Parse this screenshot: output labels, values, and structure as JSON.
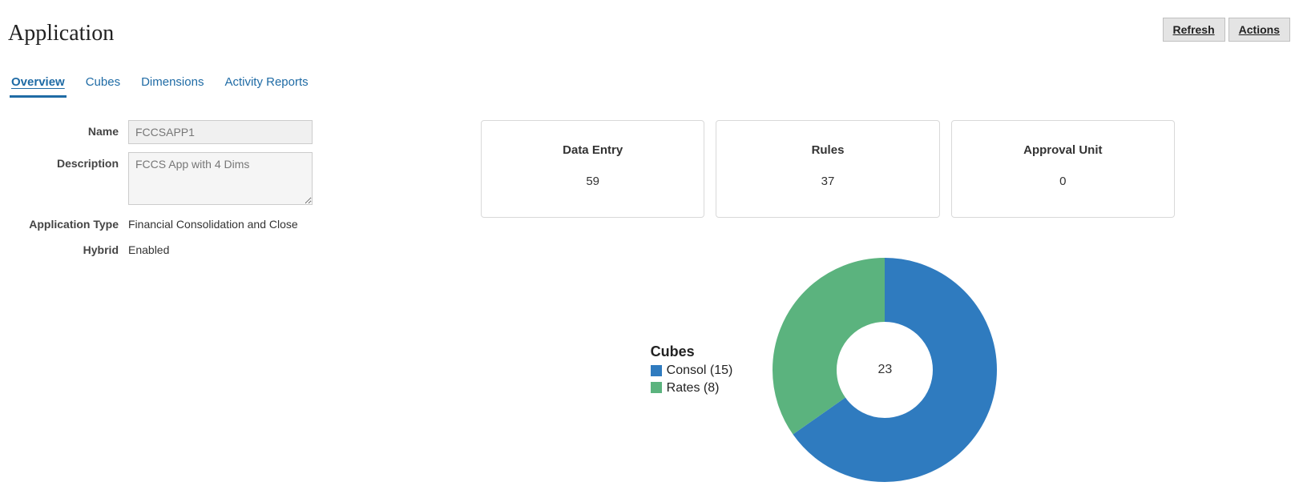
{
  "header": {
    "title": "Application",
    "refresh_label": "Refresh",
    "actions_label": "Actions"
  },
  "tabs": {
    "overview": "Overview",
    "cubes": "Cubes",
    "dimensions": "Dimensions",
    "activity": "Activity Reports"
  },
  "form": {
    "name_label": "Name",
    "name_value": "FCCSAPP1",
    "desc_label": "Description",
    "desc_value": "FCCS App with 4 Dims",
    "apptype_label": "Application Type",
    "apptype_value": "Financial Consolidation and Close",
    "hybrid_label": "Hybrid",
    "hybrid_value": "Enabled"
  },
  "stats": {
    "data_entry": {
      "label": "Data Entry",
      "value": "59"
    },
    "rules": {
      "label": "Rules",
      "value": "37"
    },
    "approval": {
      "label": "Approval Unit",
      "value": "0"
    }
  },
  "chart_data": {
    "type": "pie",
    "title": "Cubes",
    "center_total": "23",
    "series": [
      {
        "name": "Consol",
        "value": 15,
        "color": "#2f7bbf",
        "legend": "Consol (15)"
      },
      {
        "name": "Rates",
        "value": 8,
        "color": "#5bb37e",
        "legend": "Rates (8)"
      }
    ]
  }
}
